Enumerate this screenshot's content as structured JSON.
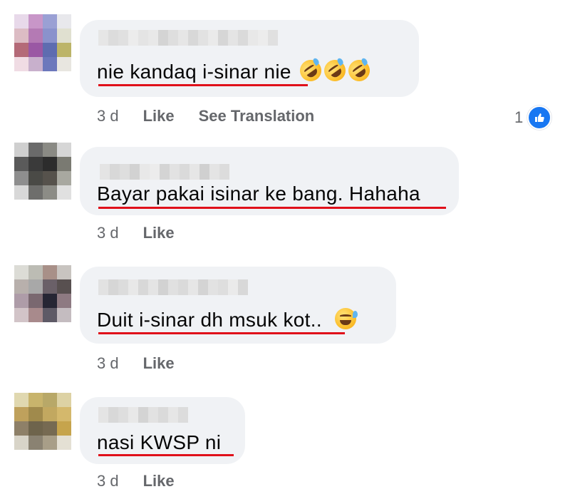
{
  "comments": [
    {
      "text": "nie kandaq i-sinar nie",
      "emojis": [
        "rolling-on-the-floor-laughing",
        "rolling-on-the-floor-laughing",
        "rolling-on-the-floor-laughing"
      ],
      "time": "3 d",
      "like_label": "Like",
      "translate_label": "See Translation",
      "reaction_count": "1"
    },
    {
      "text": "Bayar pakai isinar ke bang. Hahaha",
      "time": "3 d",
      "like_label": "Like"
    },
    {
      "text": "Duit i-sinar dh msuk kot..",
      "emojis": [
        "grinning-face-with-sweat"
      ],
      "time": "3 d",
      "like_label": "Like"
    },
    {
      "text": "nasi KWSP ni",
      "time": "3 d",
      "like_label": "Like"
    }
  ],
  "colors": {
    "underline": "#e0101a",
    "bubble": "#f0f2f5",
    "meta_text": "#65676b",
    "like_blue": "#1877f2"
  }
}
